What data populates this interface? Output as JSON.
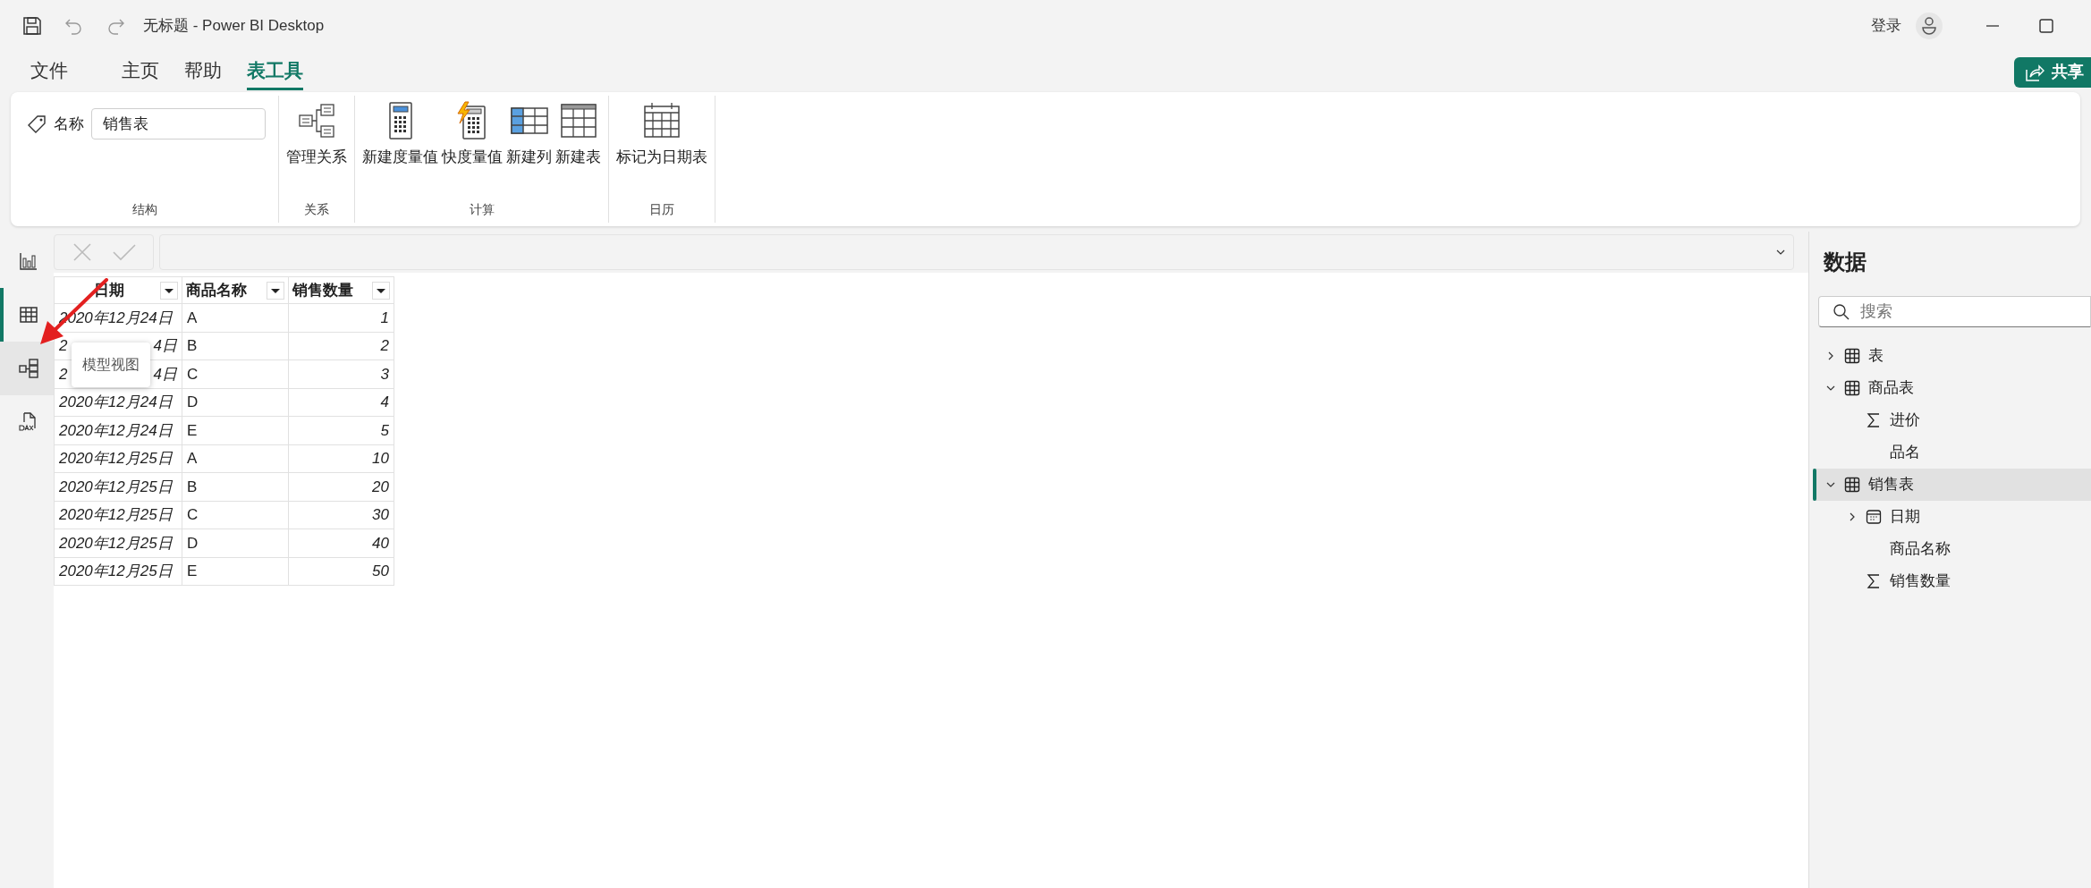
{
  "window": {
    "title": "无标题 - Power BI Desktop",
    "sign_in": "登录"
  },
  "menu_tabs": [
    {
      "label": "文件",
      "selected": false
    },
    {
      "label": "主页",
      "selected": false
    },
    {
      "label": "帮助",
      "selected": false
    },
    {
      "label": "表工具",
      "selected": true
    }
  ],
  "share_button": "共享",
  "ribbon": {
    "groups": [
      {
        "label": "结构",
        "kind": "name",
        "name_label": "名称",
        "name_value": "销售表"
      },
      {
        "label": "关系",
        "kind": "buttons",
        "buttons": [
          {
            "label": "管理关系",
            "kind": "relations"
          }
        ]
      },
      {
        "label": "计算",
        "kind": "buttons",
        "buttons": [
          {
            "label": "新建度量值",
            "kind": "measure"
          },
          {
            "label": "快度量值",
            "kind": "quick"
          },
          {
            "label": "新建列",
            "kind": "column"
          },
          {
            "label": "新建表",
            "kind": "table"
          }
        ]
      },
      {
        "label": "日历",
        "kind": "buttons",
        "buttons": [
          {
            "label": "标记为日期表",
            "kind": "calendar"
          }
        ]
      }
    ]
  },
  "nav": [
    {
      "kind": "report",
      "selected": false,
      "hovered": false
    },
    {
      "kind": "table",
      "selected": true,
      "hovered": false
    },
    {
      "kind": "model",
      "selected": false,
      "hovered": true
    },
    {
      "kind": "dax",
      "selected": false,
      "hovered": false
    }
  ],
  "tooltip": "模型视图",
  "table": {
    "columns": [
      {
        "label": "日期"
      },
      {
        "label": "商品名称"
      },
      {
        "label": "销售数量"
      }
    ],
    "rows": [
      [
        "2020年12月24日",
        "A",
        "1"
      ],
      [
        [
          "2",
          "4日"
        ],
        "B",
        "2"
      ],
      [
        [
          "2",
          "4日"
        ],
        "C",
        "3"
      ],
      [
        "2020年12月24日",
        "D",
        "4"
      ],
      [
        "2020年12月24日",
        "E",
        "5"
      ],
      [
        "2020年12月25日",
        "A",
        "10"
      ],
      [
        "2020年12月25日",
        "B",
        "20"
      ],
      [
        "2020年12月25日",
        "C",
        "30"
      ],
      [
        "2020年12月25日",
        "D",
        "40"
      ],
      [
        "2020年12月25日",
        "E",
        "50"
      ]
    ]
  },
  "data_panel": {
    "title": "数据",
    "search": {
      "placeholder": "搜索"
    },
    "tree": [
      {
        "label": "表",
        "kind": "table",
        "expanded": false,
        "selected": false
      },
      {
        "label": "商品表",
        "kind": "table",
        "expanded": true,
        "selected": false,
        "children": [
          {
            "label": "进价",
            "kind": "sum"
          },
          {
            "label": "品名",
            "kind": "text"
          }
        ]
      },
      {
        "label": "销售表",
        "kind": "table",
        "expanded": true,
        "selected": true,
        "children": [
          {
            "label": "日期",
            "kind": "date",
            "expanded": false
          },
          {
            "label": "商品名称",
            "kind": "text"
          },
          {
            "label": "销售数量",
            "kind": "sum"
          }
        ]
      }
    ]
  }
}
